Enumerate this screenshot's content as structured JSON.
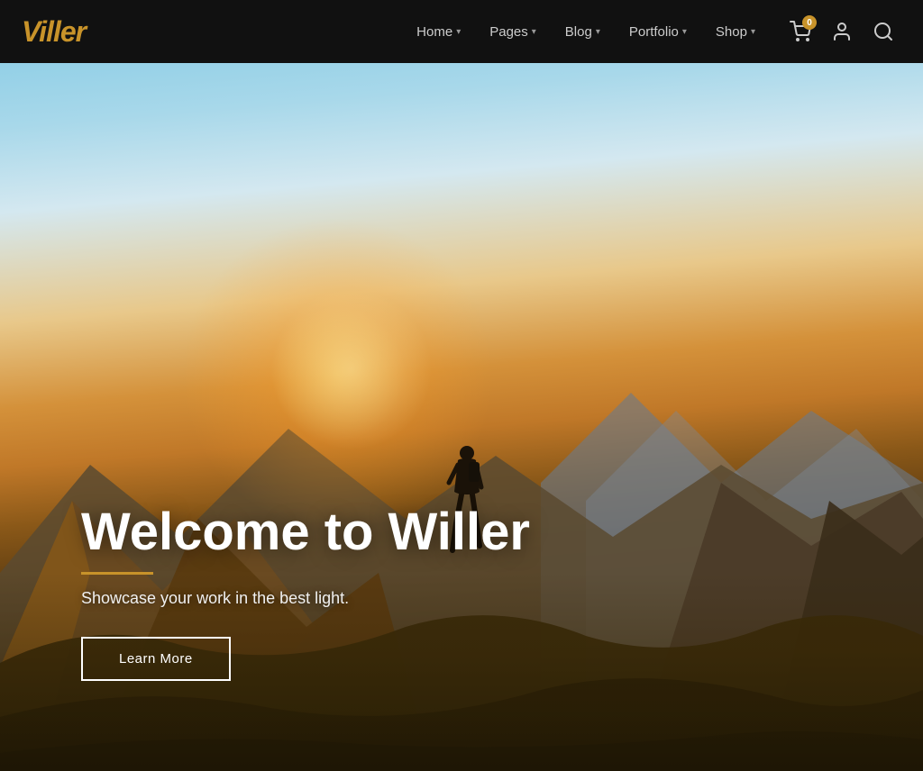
{
  "brand": {
    "name_prefix": "Vill",
    "name_highlight": "e",
    "name_suffix": "r"
  },
  "nav": {
    "links": [
      {
        "label": "Home",
        "has_dropdown": true
      },
      {
        "label": "Pages",
        "has_dropdown": true
      },
      {
        "label": "Blog",
        "has_dropdown": true
      },
      {
        "label": "Portfolio",
        "has_dropdown": true
      },
      {
        "label": "Shop",
        "has_dropdown": true
      }
    ],
    "cart_count": "0",
    "cart_label": "Cart",
    "account_label": "Account",
    "search_label": "Search"
  },
  "hero": {
    "title": "Welcome to Willer",
    "subtitle": "Showcase your work in the best light.",
    "cta_label": "Learn More",
    "divider_color": "#c8932a"
  }
}
